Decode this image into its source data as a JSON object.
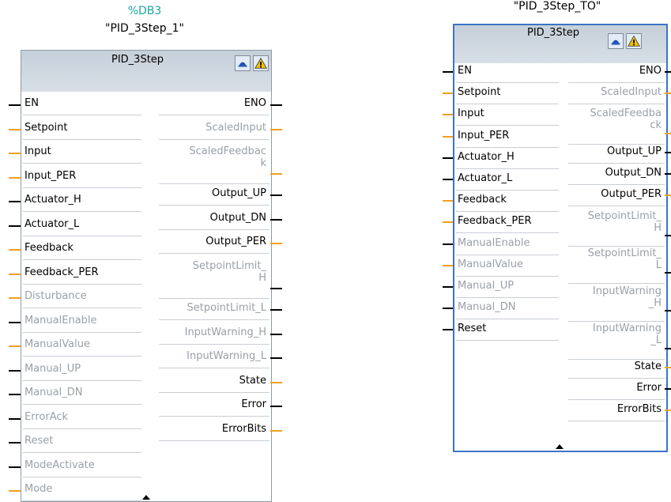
{
  "block1": {
    "db_number": "%DB3",
    "instance_name": "\"PID_3Step_1\"",
    "title": "PID_3Step",
    "inputs": [
      {
        "label": "EN",
        "type": "bool",
        "state": "enabled"
      },
      {
        "label": "Setpoint",
        "type": "real",
        "state": "enabled"
      },
      {
        "label": "Input",
        "type": "real",
        "state": "enabled"
      },
      {
        "label": "Input_PER",
        "type": "real",
        "state": "enabled"
      },
      {
        "label": "Actuator_H",
        "type": "bool",
        "state": "enabled"
      },
      {
        "label": "Actuator_L",
        "type": "bool",
        "state": "enabled"
      },
      {
        "label": "Feedback",
        "type": "real",
        "state": "enabled"
      },
      {
        "label": "Feedback_PER",
        "type": "real",
        "state": "enabled"
      },
      {
        "label": "Disturbance",
        "type": "real",
        "state": "disabled"
      },
      {
        "label": "ManualEnable",
        "type": "bool",
        "state": "disabled"
      },
      {
        "label": "ManualValue",
        "type": "real",
        "state": "disabled"
      },
      {
        "label": "Manual_UP",
        "type": "bool",
        "state": "disabled"
      },
      {
        "label": "Manual_DN",
        "type": "bool",
        "state": "disabled"
      },
      {
        "label": "ErrorAck",
        "type": "bool",
        "state": "disabled"
      },
      {
        "label": "Reset",
        "type": "bool",
        "state": "disabled"
      },
      {
        "label": "ModeActivate",
        "type": "bool",
        "state": "disabled"
      },
      {
        "label": "Mode",
        "type": "real",
        "state": "disabled"
      }
    ],
    "outputs": [
      {
        "label": "ENO",
        "type": "bool",
        "state": "enabled"
      },
      {
        "label": "ScaledInput",
        "type": "real",
        "state": "disabled"
      },
      {
        "label": "ScaledFeedbac",
        "label2": "k",
        "type": "real",
        "state": "disabled"
      },
      {
        "label": "Output_UP",
        "type": "bool",
        "state": "enabled"
      },
      {
        "label": "Output_DN",
        "type": "bool",
        "state": "enabled"
      },
      {
        "label": "Output_PER",
        "type": "real",
        "state": "enabled"
      },
      {
        "label": "SetpointLimit_",
        "label2": "H",
        "type": "bool",
        "state": "disabled"
      },
      {
        "label": "SetpointLimit_L",
        "type": "bool",
        "state": "disabled"
      },
      {
        "label": "InputWarning_H",
        "type": "bool",
        "state": "disabled"
      },
      {
        "label": "InputWarning_L",
        "type": "bool",
        "state": "disabled"
      },
      {
        "label": "State",
        "type": "real",
        "state": "enabled"
      },
      {
        "label": "Error",
        "type": "bool",
        "state": "enabled"
      },
      {
        "label": "ErrorBits",
        "type": "real",
        "state": "enabled"
      }
    ]
  },
  "block2": {
    "instance_name": "\"PID_3Step_TO\"",
    "title": "PID_3Step",
    "inputs": [
      {
        "label": "EN",
        "type": "bool",
        "state": "enabled"
      },
      {
        "label": "Setpoint",
        "type": "real",
        "state": "enabled"
      },
      {
        "label": "Input",
        "type": "real",
        "state": "enabled"
      },
      {
        "label": "Input_PER",
        "type": "real",
        "state": "enabled"
      },
      {
        "label": "Actuator_H",
        "type": "bool",
        "state": "enabled"
      },
      {
        "label": "Actuator_L",
        "type": "bool",
        "state": "enabled"
      },
      {
        "label": "Feedback",
        "type": "real",
        "state": "enabled"
      },
      {
        "label": "Feedback_PER",
        "type": "real",
        "state": "enabled"
      },
      {
        "label": "ManualEnable",
        "type": "bool",
        "state": "disabled"
      },
      {
        "label": "ManualValue",
        "type": "real",
        "state": "disabled"
      },
      {
        "label": "Manual_UP",
        "type": "bool",
        "state": "disabled"
      },
      {
        "label": "Manual_DN",
        "type": "bool",
        "state": "disabled"
      },
      {
        "label": "Reset",
        "type": "bool",
        "state": "enabled"
      }
    ],
    "outputs": [
      {
        "label": "ENO",
        "type": "bool",
        "state": "enabled"
      },
      {
        "label": "ScaledInput",
        "type": "real",
        "state": "disabled"
      },
      {
        "label": "ScaledFeedba",
        "label2": "ck",
        "type": "real",
        "state": "disabled"
      },
      {
        "label": "Output_UP",
        "type": "bool",
        "state": "enabled"
      },
      {
        "label": "Output_DN",
        "type": "bool",
        "state": "enabled"
      },
      {
        "label": "Output_PER",
        "type": "real",
        "state": "enabled"
      },
      {
        "label": "SetpointLimit_",
        "label2": "H",
        "type": "bool",
        "state": "disabled"
      },
      {
        "label": "SetpointLimit_",
        "label2": "L",
        "type": "bool",
        "state": "disabled"
      },
      {
        "label": "InputWarning",
        "label2": "_H",
        "type": "bool",
        "state": "disabled"
      },
      {
        "label": "InputWarning",
        "label2": "_L",
        "type": "bool",
        "state": "disabled"
      },
      {
        "label": "State",
        "type": "real",
        "state": "enabled"
      },
      {
        "label": "Error",
        "type": "bool",
        "state": "enabled"
      },
      {
        "label": "ErrorBits",
        "type": "real",
        "state": "enabled"
      }
    ]
  },
  "icons": {
    "online": "monitor-icon",
    "warning": "warning-icon"
  },
  "colors": {
    "bool_pin": "#000000",
    "real_pin": "#f0a020",
    "selected_border": "#3d73c8",
    "db_number": "#1aa7a1",
    "disabled_text": "#9aa0a6"
  }
}
